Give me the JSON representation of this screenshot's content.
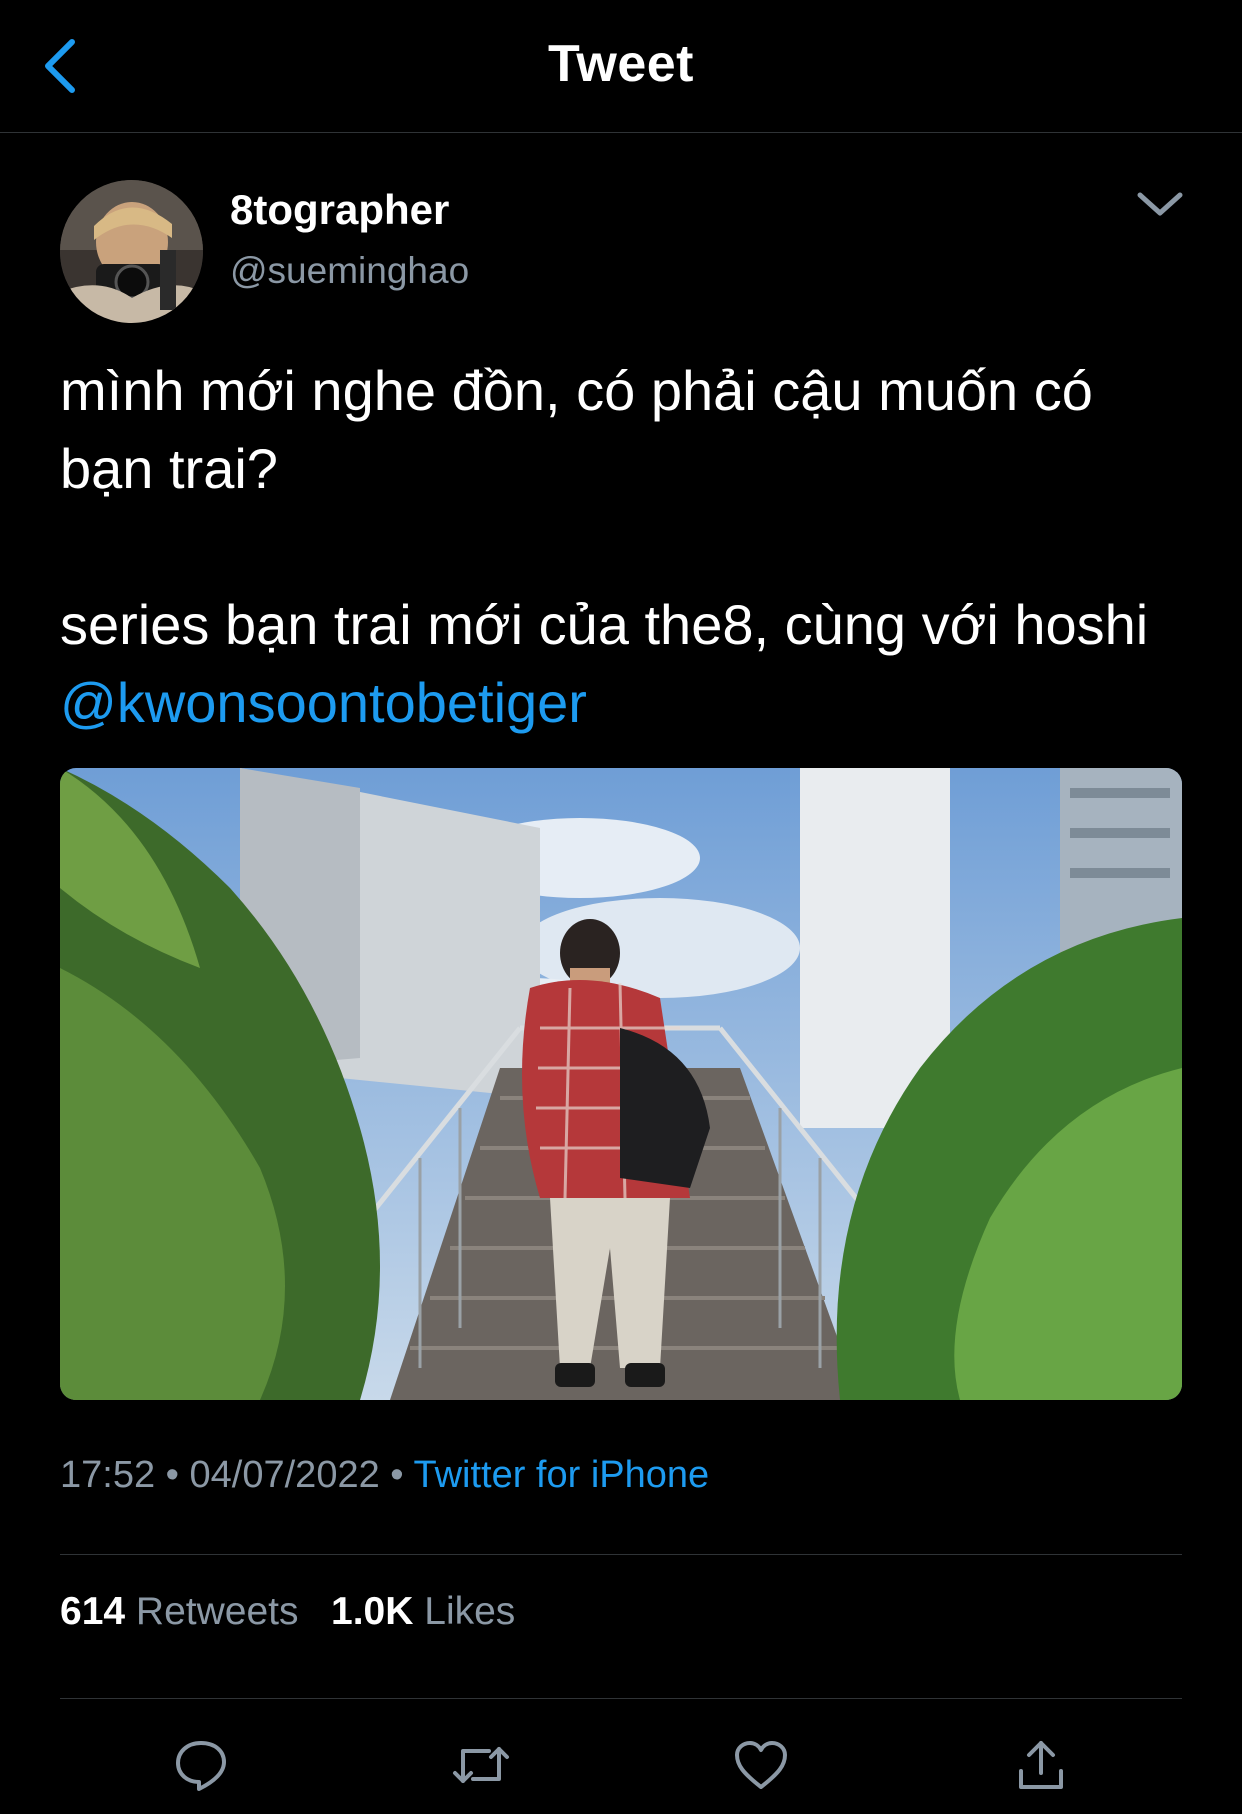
{
  "header": {
    "title": "Tweet",
    "back_icon": "chevron-left-icon"
  },
  "author": {
    "display_name": "8tographer",
    "handle": "@sueminghao",
    "menu_icon": "chevron-down-icon"
  },
  "tweet": {
    "line1": "mình mới nghe đồn, có phải cậu muốn có bạn trai?",
    "line2_text": "series bạn trai mới của the8, cùng với hoshi ",
    "mention": "@kwonsoontobetiger"
  },
  "meta": {
    "time": "17:52",
    "separator": "•",
    "date": "04/07/2022",
    "source": "Twitter for iPhone"
  },
  "stats": {
    "retweets_count": "614",
    "retweets_label": "Retweets",
    "likes_count": "1.0K",
    "likes_label": "Likes"
  },
  "actions": {
    "reply_icon": "reply-icon",
    "retweet_icon": "retweet-icon",
    "like_icon": "heart-icon",
    "share_icon": "share-icon"
  },
  "colors": {
    "background": "#000000",
    "accent": "#1d9bf0",
    "secondary_text": "#8b98a5",
    "divider": "#2f3336"
  }
}
